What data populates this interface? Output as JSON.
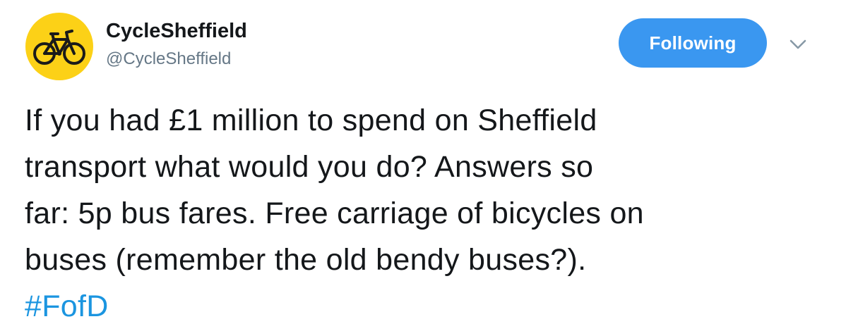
{
  "author": {
    "display_name": "CycleSheffield",
    "handle": "@CycleSheffield",
    "avatar_icon": "bicycle-icon",
    "avatar_color": "#fcd117"
  },
  "follow_button": {
    "label": "Following",
    "color": "#3a97f0"
  },
  "menu": {
    "icon": "chevron-down-icon"
  },
  "tweet": {
    "lines": [
      "If you had £1 million to spend on Sheffield",
      "transport what would you do? Answers so",
      "far: 5p bus fares. Free carriage of bicycles on",
      "buses (remember the old bendy buses?)."
    ],
    "hashtag": "#FofD",
    "hashtag_color": "#1b95e0"
  }
}
